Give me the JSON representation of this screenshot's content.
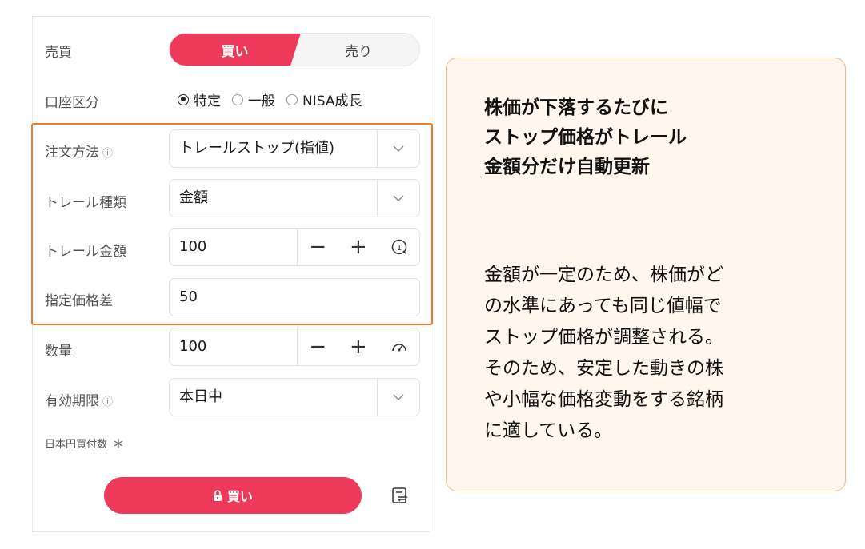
{
  "form": {
    "side_label": "売買",
    "buy_label": "買い",
    "sell_label": "売り",
    "account_label": "口座区分",
    "account_options": [
      "特定",
      "一般",
      "NISA成長"
    ],
    "account_selected": "特定",
    "order_method_label": "注文方法",
    "order_method_value": "トレールストップ(指値)",
    "trail_type_label": "トレール種類",
    "trail_type_value": "金額",
    "trail_amount_label": "トレール金額",
    "trail_amount_value": "100",
    "price_diff_label": "指定価格差",
    "price_diff_value": "50",
    "quantity_label": "数量",
    "quantity_value": "100",
    "expiry_label": "有効期限",
    "expiry_value": "本日中",
    "jpy_amount_label": "日本円買付数",
    "submit_label": "買い",
    "info_icon": "ⓘ",
    "minus": "−",
    "plus": "+"
  },
  "callout": {
    "title_lines": [
      "株価が下落するたびに",
      "ストップ価格がトレール",
      "金額分だけ自動更新"
    ],
    "body_lines": [
      "金額が一定のため、株価がど",
      "の水準にあっても同じ値幅で",
      "ストップ価格が調整される。",
      "そのため、安定した動きの株",
      "や小幅な価格変動をする銘柄",
      "に適している。"
    ]
  },
  "colors": {
    "accent": "#ee3a5a",
    "highlight": "#f07a2a",
    "callout_bg": "#fff7ee"
  }
}
